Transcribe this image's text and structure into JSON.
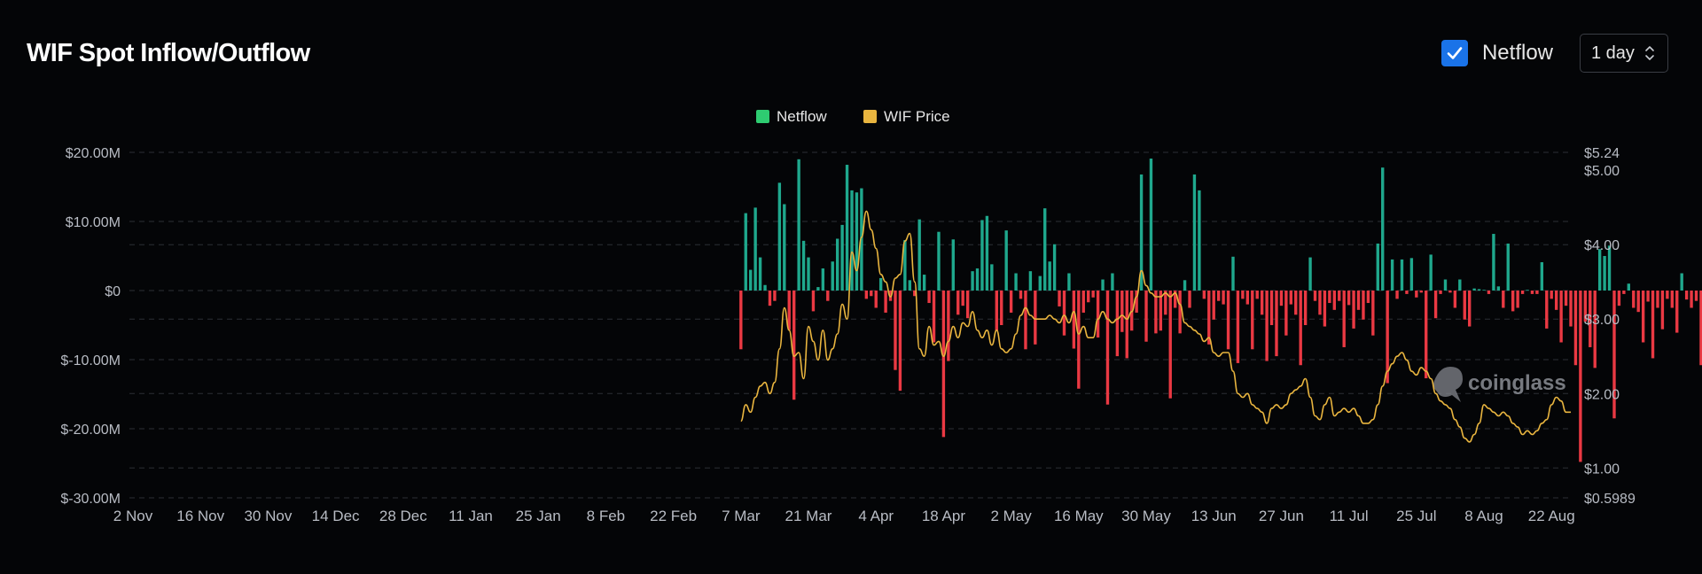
{
  "header": {
    "title": "WIF Spot Inflow/Outflow",
    "netflow_checked": true,
    "netflow_label": "Netflow",
    "interval_value": "1 day"
  },
  "watermark": "coinglass",
  "colors": {
    "inflow": "#1fa88d",
    "outflow": "#ea3943",
    "price": "#e9b53f",
    "legend_netflow": "#2ecc71",
    "legend_price": "#e9b53f",
    "grid": "#2b2e35",
    "axis_text": "#b8bcc4",
    "checkbox": "#1a73e8"
  },
  "chart_data": {
    "type": "bar",
    "legend": [
      {
        "name": "Netflow",
        "color": "#2ecc71"
      },
      {
        "name": "WIF Price",
        "color": "#e9b53f"
      }
    ],
    "legend_position": "top-center",
    "grid": true,
    "x_axis": {
      "range": [
        "2023-11-02",
        "2024-08-26"
      ],
      "ticks": [
        "2 Nov",
        "16 Nov",
        "30 Nov",
        "14 Dec",
        "28 Dec",
        "11 Jan",
        "25 Jan",
        "8 Feb",
        "22 Feb",
        "7 Mar",
        "21 Mar",
        "4 Apr",
        "18 Apr",
        "2 May",
        "16 May",
        "30 May",
        "13 Jun",
        "27 Jun",
        "11 Jul",
        "25 Jul",
        "8 Aug",
        "22 Aug"
      ]
    },
    "y_left": {
      "label": "",
      "ylim": [
        -30,
        20
      ],
      "ticks": [
        20,
        10,
        0,
        -10,
        -20,
        -30
      ],
      "tick_labels": [
        "$20.00M",
        "$10.00M",
        "$0",
        "$-10.00M",
        "$-20.00M",
        "$-30.00M"
      ]
    },
    "y_right": {
      "label": "",
      "ylim": [
        0.5989,
        5.24
      ],
      "ticks": [
        5.24,
        5.0,
        4.0,
        3.0,
        2.0,
        1.0,
        0.5989
      ],
      "tick_labels": [
        "$5.24",
        "$5.00",
        "$4.00",
        "$3.00",
        "$2.00",
        "$1.00",
        "$0.5989"
      ]
    },
    "series": [
      {
        "name": "Netflow",
        "axis": "left",
        "start_date": "2024-03-07",
        "values": [
          -8.5,
          11.2,
          3,
          12,
          4.8,
          0.8,
          -2.2,
          -1.5,
          15.6,
          12.5,
          -5.7,
          -15.8,
          19,
          7.2,
          4.8,
          -3,
          0.5,
          3.2,
          -1.5,
          4.2,
          7.5,
          9.5,
          18.2,
          14.5,
          14.2,
          14.8,
          -1.2,
          -0.8,
          -2.5,
          1.8,
          -3.2,
          -1.5,
          -11.5,
          -14.5,
          7.3,
          1.5,
          -0.8,
          10.3,
          2.3,
          -1.8,
          -7.5,
          8.5,
          -21.2,
          -10.2,
          7.4,
          -3.5,
          -2.2,
          -4,
          2.8,
          3.2,
          10.2,
          10.8,
          3.8,
          -5.8,
          -5,
          8.7,
          -3.2,
          2.5,
          -1.2,
          -8.5,
          2.8,
          -7.8,
          2.1,
          11.9,
          4.2,
          6.7,
          -2.3,
          -6.5,
          2.5,
          -8.4,
          -14.2,
          -3.2,
          -1.7,
          -1,
          -6.8,
          1.6,
          -16.5,
          2.5,
          -9.5,
          -6,
          -9.8,
          -5.8,
          -3.2,
          16.8,
          -7.4,
          19.1,
          -6.2,
          -5.8,
          -3.5,
          -15.6,
          -2.5,
          -6.2,
          1.5,
          -2.5,
          16.8,
          14.5,
          -1.2,
          -7.8,
          -4.2,
          -1.5,
          -2,
          -8.5,
          4.9,
          -10.5,
          -1.2,
          -2,
          -8.5,
          -1.2,
          -3.5,
          -10.2,
          -5,
          -9.5,
          -2.2,
          -6.5,
          -2,
          -3.5,
          -10.8,
          -5,
          4.8,
          -1.5,
          -3.5,
          -5.2,
          -1.8,
          -2.8,
          -1.5,
          -8.2,
          -2.1,
          -5.5,
          -2.8,
          -4.2,
          -1.8,
          -6.5,
          6.8,
          17.8,
          -13.4,
          4.5,
          -1.2,
          4.5,
          -0.5,
          4.7,
          -1,
          -0.3,
          -12.7,
          5.2,
          -4,
          -0.5,
          1.6,
          -0.3,
          -2.5,
          1.6,
          -4.2,
          -5.2,
          0.3,
          0.2,
          0.1,
          -0.5,
          8.2,
          0.6,
          -2.5,
          6.8,
          -3,
          -2.5,
          -0.5,
          0.1,
          -0.5,
          -0.5,
          4.1,
          -5.5,
          -1.2,
          -2.8,
          -7.5,
          -2.2,
          -5.2,
          -10.8,
          -24.8,
          -4.5,
          -8.2,
          -11.2,
          6,
          5,
          6.5,
          -18.5,
          -2.2,
          -0.5,
          1,
          -2.5,
          -3.1,
          -7.5,
          -1.6,
          -9.8,
          -2.5,
          -5.6,
          -1.2,
          -2.5,
          -6.1,
          2.5,
          -1.3,
          -2.5,
          -1.5,
          -10.8,
          -12,
          1
        ]
      },
      {
        "name": "WIF Price",
        "axis": "right",
        "type": "line",
        "points": [
          [
            "2024-03-07",
            1.63
          ],
          [
            "2024-03-08",
            1.85
          ],
          [
            "2024-03-09",
            1.75
          ],
          [
            "2024-03-10",
            1.95
          ],
          [
            "2024-03-11",
            2.1
          ],
          [
            "2024-03-12",
            2.15
          ],
          [
            "2024-03-13",
            2.0
          ],
          [
            "2024-03-14",
            2.15
          ],
          [
            "2024-03-15",
            2.6
          ],
          [
            "2024-03-16",
            3.15
          ],
          [
            "2024-03-17",
            2.85
          ],
          [
            "2024-03-18",
            2.5
          ],
          [
            "2024-03-19",
            2.55
          ],
          [
            "2024-03-20",
            2.2
          ],
          [
            "2024-03-21",
            2.9
          ],
          [
            "2024-03-22",
            2.7
          ],
          [
            "2024-03-23",
            2.45
          ],
          [
            "2024-03-24",
            2.85
          ],
          [
            "2024-03-25",
            2.45
          ],
          [
            "2024-03-26",
            2.6
          ],
          [
            "2024-03-27",
            2.8
          ],
          [
            "2024-03-28",
            3.2
          ],
          [
            "2024-03-29",
            3.0
          ],
          [
            "2024-03-30",
            3.9
          ],
          [
            "2024-03-31",
            3.65
          ],
          [
            "2024-04-01",
            4.1
          ],
          [
            "2024-04-02",
            4.45
          ],
          [
            "2024-04-03",
            4.2
          ],
          [
            "2024-04-04",
            3.95
          ],
          [
            "2024-04-05",
            3.6
          ],
          [
            "2024-04-06",
            3.5
          ],
          [
            "2024-04-07",
            3.3
          ],
          [
            "2024-04-08",
            3.55
          ],
          [
            "2024-04-09",
            3.6
          ],
          [
            "2024-04-10",
            4.05
          ],
          [
            "2024-04-11",
            4.15
          ],
          [
            "2024-04-12",
            3.5
          ],
          [
            "2024-04-13",
            2.6
          ],
          [
            "2024-04-14",
            2.5
          ],
          [
            "2024-04-15",
            2.9
          ],
          [
            "2024-04-16",
            2.65
          ],
          [
            "2024-04-17",
            2.7
          ],
          [
            "2024-04-18",
            2.5
          ],
          [
            "2024-04-19",
            2.7
          ],
          [
            "2024-04-20",
            2.9
          ],
          [
            "2024-04-21",
            2.75
          ],
          [
            "2024-04-22",
            2.95
          ],
          [
            "2024-04-23",
            2.9
          ],
          [
            "2024-04-24",
            3.1
          ],
          [
            "2024-04-25",
            2.85
          ],
          [
            "2024-04-26",
            2.75
          ],
          [
            "2024-04-27",
            2.85
          ],
          [
            "2024-04-28",
            2.65
          ],
          [
            "2024-04-29",
            2.85
          ],
          [
            "2024-04-30",
            2.6
          ],
          [
            "2024-05-01",
            2.55
          ],
          [
            "2024-05-02",
            2.6
          ],
          [
            "2024-05-03",
            2.8
          ],
          [
            "2024-05-04",
            3.05
          ],
          [
            "2024-05-05",
            3.15
          ],
          [
            "2024-05-06",
            3.05
          ],
          [
            "2024-05-07",
            3.0
          ],
          [
            "2024-05-08",
            3.0
          ],
          [
            "2024-05-09",
            3.0
          ],
          [
            "2024-05-10",
            3.05
          ],
          [
            "2024-05-11",
            3.0
          ],
          [
            "2024-05-12",
            2.95
          ],
          [
            "2024-05-13",
            3.05
          ],
          [
            "2024-05-14",
            2.95
          ],
          [
            "2024-05-15",
            3.1
          ],
          [
            "2024-05-16",
            2.8
          ],
          [
            "2024-05-17",
            2.9
          ],
          [
            "2024-05-18",
            2.75
          ],
          [
            "2024-05-19",
            2.75
          ],
          [
            "2024-05-20",
            3.0
          ],
          [
            "2024-05-21",
            3.1
          ],
          [
            "2024-05-22",
            3.0
          ],
          [
            "2024-05-23",
            2.95
          ],
          [
            "2024-05-24",
            3.0
          ],
          [
            "2024-05-25",
            3.05
          ],
          [
            "2024-05-26",
            3.0
          ],
          [
            "2024-05-27",
            3.1
          ],
          [
            "2024-05-28",
            3.3
          ],
          [
            "2024-05-29",
            3.65
          ],
          [
            "2024-05-30",
            3.45
          ],
          [
            "2024-05-31",
            3.35
          ],
          [
            "2024-06-01",
            3.3
          ],
          [
            "2024-06-02",
            3.3
          ],
          [
            "2024-06-03",
            3.35
          ],
          [
            "2024-06-04",
            3.3
          ],
          [
            "2024-06-05",
            3.35
          ],
          [
            "2024-06-06",
            3.2
          ],
          [
            "2024-06-07",
            2.95
          ],
          [
            "2024-06-08",
            2.9
          ],
          [
            "2024-06-09",
            2.85
          ],
          [
            "2024-06-10",
            2.8
          ],
          [
            "2024-06-11",
            2.7
          ],
          [
            "2024-06-12",
            2.75
          ],
          [
            "2024-06-13",
            2.55
          ],
          [
            "2024-06-14",
            2.5
          ],
          [
            "2024-06-15",
            2.55
          ],
          [
            "2024-06-16",
            2.55
          ],
          [
            "2024-06-17",
            2.3
          ],
          [
            "2024-06-18",
            2.0
          ],
          [
            "2024-06-19",
            1.95
          ],
          [
            "2024-06-20",
            2.0
          ],
          [
            "2024-06-21",
            1.85
          ],
          [
            "2024-06-22",
            1.8
          ],
          [
            "2024-06-23",
            1.75
          ],
          [
            "2024-06-24",
            1.6
          ],
          [
            "2024-06-25",
            1.8
          ],
          [
            "2024-06-26",
            1.85
          ],
          [
            "2024-06-27",
            1.8
          ],
          [
            "2024-06-28",
            1.85
          ],
          [
            "2024-06-29",
            2.0
          ],
          [
            "2024-06-30",
            2.05
          ],
          [
            "2024-07-01",
            2.1
          ],
          [
            "2024-07-02",
            2.2
          ],
          [
            "2024-07-03",
            1.95
          ],
          [
            "2024-07-04",
            1.7
          ],
          [
            "2024-07-05",
            1.65
          ],
          [
            "2024-07-06",
            1.85
          ],
          [
            "2024-07-07",
            1.95
          ],
          [
            "2024-07-08",
            1.7
          ],
          [
            "2024-07-09",
            1.75
          ],
          [
            "2024-07-10",
            1.8
          ],
          [
            "2024-07-11",
            1.75
          ],
          [
            "2024-07-12",
            1.8
          ],
          [
            "2024-07-13",
            1.7
          ],
          [
            "2024-07-14",
            1.6
          ],
          [
            "2024-07-15",
            1.6
          ],
          [
            "2024-07-16",
            1.65
          ],
          [
            "2024-07-17",
            1.85
          ],
          [
            "2024-07-18",
            2.1
          ],
          [
            "2024-07-19",
            2.3
          ],
          [
            "2024-07-20",
            2.4
          ],
          [
            "2024-07-21",
            2.5
          ],
          [
            "2024-07-22",
            2.55
          ],
          [
            "2024-07-23",
            2.45
          ],
          [
            "2024-07-24",
            2.3
          ],
          [
            "2024-07-25",
            2.25
          ],
          [
            "2024-07-26",
            2.35
          ],
          [
            "2024-07-27",
            2.3
          ],
          [
            "2024-07-28",
            2.2
          ],
          [
            "2024-07-29",
            2.0
          ],
          [
            "2024-07-30",
            1.9
          ],
          [
            "2024-07-31",
            1.85
          ],
          [
            "2024-08-01",
            1.8
          ],
          [
            "2024-08-02",
            1.65
          ],
          [
            "2024-08-03",
            1.55
          ],
          [
            "2024-08-04",
            1.4
          ],
          [
            "2024-08-05",
            1.35
          ],
          [
            "2024-08-06",
            1.45
          ],
          [
            "2024-08-07",
            1.6
          ],
          [
            "2024-08-08",
            1.85
          ],
          [
            "2024-08-09",
            1.8
          ],
          [
            "2024-08-10",
            1.75
          ],
          [
            "2024-08-11",
            1.7
          ],
          [
            "2024-08-12",
            1.75
          ],
          [
            "2024-08-13",
            1.7
          ],
          [
            "2024-08-14",
            1.6
          ],
          [
            "2024-08-15",
            1.55
          ],
          [
            "2024-08-16",
            1.45
          ],
          [
            "2024-08-17",
            1.5
          ],
          [
            "2024-08-18",
            1.45
          ],
          [
            "2024-08-19",
            1.5
          ],
          [
            "2024-08-20",
            1.6
          ],
          [
            "2024-08-21",
            1.65
          ],
          [
            "2024-08-22",
            1.85
          ],
          [
            "2024-08-23",
            1.95
          ],
          [
            "2024-08-24",
            1.9
          ],
          [
            "2024-08-25",
            1.75
          ],
          [
            "2024-08-26",
            1.75
          ]
        ]
      }
    ]
  }
}
